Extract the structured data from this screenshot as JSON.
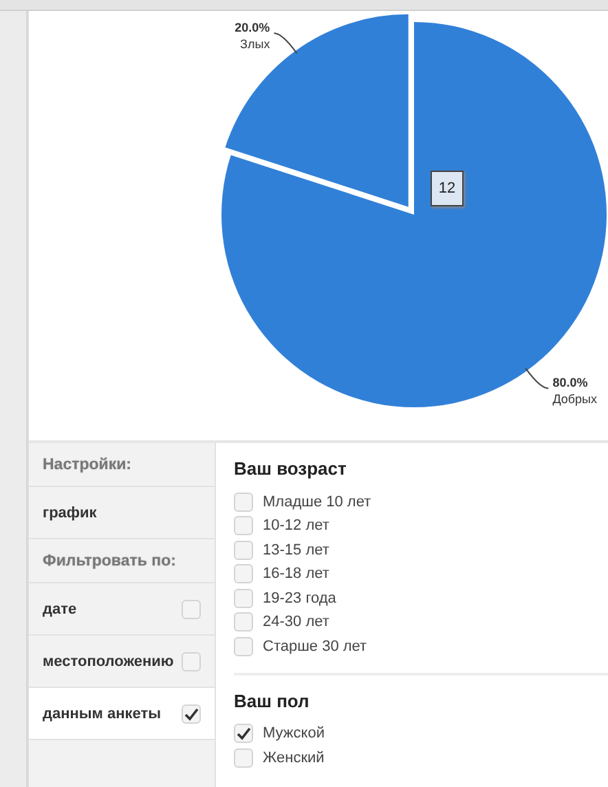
{
  "chart": {
    "tooltip": "12",
    "chart_data": {
      "type": "pie",
      "categories": [
        "Добрых",
        "Злых"
      ],
      "series": [
        {
          "color": "#3180d8",
          "values": [
            80,
            20
          ]
        }
      ],
      "value_labels": [
        "80.0%",
        "20.0%"
      ]
    }
  },
  "sidebar": {
    "sections": [
      {
        "title": "Настройки:",
        "items": [
          {
            "label": "график",
            "kind": "link"
          }
        ]
      },
      {
        "title": "Фильтровать по:",
        "items": [
          {
            "label": "дате",
            "kind": "filter",
            "checked": false
          },
          {
            "label": "местоположению",
            "kind": "filter",
            "checked": false
          },
          {
            "label": "данным анкеты",
            "kind": "filter",
            "checked": true
          }
        ]
      }
    ]
  },
  "questions": [
    {
      "title": "Ваш возраст",
      "options": [
        {
          "label": "Младше 10 лет",
          "checked": false
        },
        {
          "label": "10-12 лет",
          "checked": false
        },
        {
          "label": "13-15 лет",
          "checked": false
        },
        {
          "label": "16-18 лет",
          "checked": false
        },
        {
          "label": "19-23 года",
          "checked": false
        },
        {
          "label": "24-30 лет",
          "checked": false
        },
        {
          "label": "Старше 30 лет",
          "checked": false
        }
      ]
    },
    {
      "title": "Ваш пол",
      "options": [
        {
          "label": "Мужской",
          "checked": true
        },
        {
          "label": "Женский",
          "checked": false
        }
      ]
    }
  ]
}
